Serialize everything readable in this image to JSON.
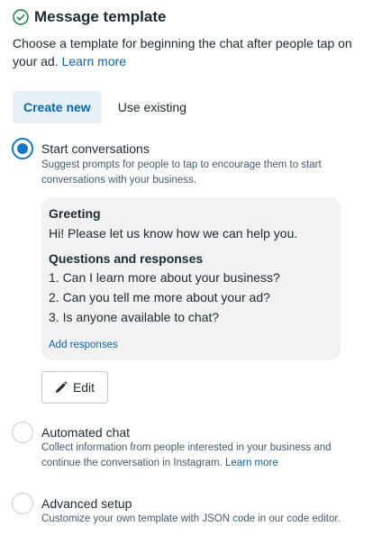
{
  "header": {
    "title": "Message template",
    "description_prefix": "Choose a template for beginning the chat after people tap on your ad.",
    "learn_more": "Learn more"
  },
  "tabs": [
    {
      "label": "Create new",
      "active": true
    },
    {
      "label": "Use existing",
      "active": false
    }
  ],
  "options": [
    {
      "label": "Start conversations",
      "sub": "Suggest prompts for people to tap to encourage them to start conversations with your business.",
      "selected": true
    },
    {
      "label": "Automated chat",
      "sub_prefix": "Collect information from people interested in your business and continue the conversation in Instagram.",
      "sub_link": "Learn more",
      "selected": false
    },
    {
      "label": "Advanced setup",
      "sub": "Customize your own template with JSON code in our code editor.",
      "selected": false
    }
  ],
  "card": {
    "greeting_heading": "Greeting",
    "greeting_text": "Hi! Please let us know how we can help you.",
    "qa_heading": "Questions and responses",
    "questions": [
      "1. Can I learn more about your business?",
      "2. Can you tell me more about your ad?",
      "3. Is anyone available to chat?"
    ],
    "add_responses": "Add responses"
  },
  "edit_button": {
    "label": "Edit",
    "icon": "pencil-icon"
  },
  "colors": {
    "accent": "#1877c2",
    "link": "#0a66a8",
    "tab_active_bg": "#e6f1fa",
    "card_bg": "#f2f2f2",
    "text": "#1c2b33",
    "subtext": "#465a69"
  }
}
